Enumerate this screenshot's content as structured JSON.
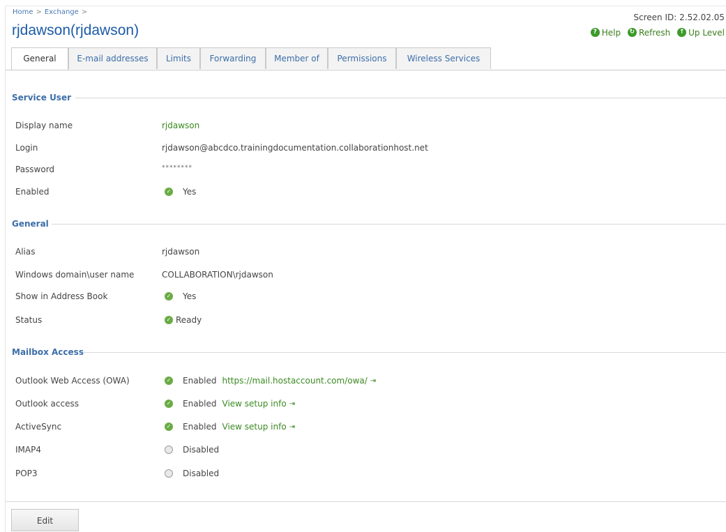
{
  "breadcrumb": {
    "home": "Home",
    "exchange": "Exchange",
    "sep": ">"
  },
  "title": "rjdawson(rjdawson)",
  "screen_id": "Screen ID: 2.52.02.05",
  "toplinks": {
    "help": "Help",
    "refresh": "Refresh",
    "up": "Up Level"
  },
  "tabs": [
    "General",
    "E-mail addresses",
    "Limits",
    "Forwarding",
    "Member of",
    "Permissions",
    "Wireless Services"
  ],
  "sections": {
    "service_user": {
      "title": "Service User",
      "display_name_label": "Display name",
      "display_name": "rjdawson",
      "login_label": "Login",
      "login": "rjdawson@abcdco.trainingdocumentation.collaborationhost.net",
      "password_label": "Password",
      "password": "********",
      "enabled_label": "Enabled",
      "enabled": "Yes"
    },
    "general": {
      "title": "General",
      "alias_label": "Alias",
      "alias": "rjdawson",
      "domain_label": "Windows domain\\user name",
      "domain": "COLLABORATION\\rjdawson",
      "address_book_label": "Show in Address Book",
      "address_book": "Yes",
      "status_label": "Status",
      "status": "Ready"
    },
    "mailbox": {
      "title": "Mailbox Access",
      "owa_label": "Outlook Web Access (OWA)",
      "owa_status": "Enabled",
      "owa_link": "https://mail.hostaccount.com/owa/",
      "outlook_label": "Outlook access",
      "outlook_status": "Enabled",
      "outlook_link": "View setup info",
      "activesync_label": "ActiveSync",
      "activesync_status": "Enabled",
      "activesync_link": "View setup info",
      "imap_label": "IMAP4",
      "imap_status": "Disabled",
      "pop_label": "POP3",
      "pop_status": "Disabled"
    }
  },
  "edit_button": "Edit",
  "icons": {
    "ok": "check-circle-icon",
    "off": "radio-off-icon",
    "external": "external-link-icon"
  },
  "colors": {
    "accent_blue": "#1c5ba6",
    "accent_green": "#3a8a21"
  }
}
